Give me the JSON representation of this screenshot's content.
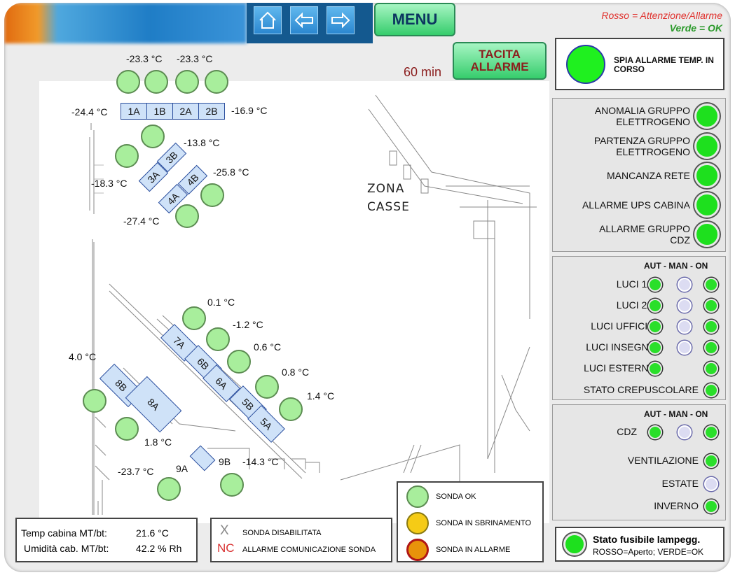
{
  "nav": {
    "menu_label": "MENU",
    "legend_red": "Rosso = Attenzione/Allarme",
    "legend_green": "Verde = OK"
  },
  "alarm": {
    "timer": "60 min",
    "tacita_line1": "TACITA",
    "tacita_line2": "ALLARME",
    "spia_label": "SPIA ALLARME TEMP. IN CORSO",
    "spia_color": "#1ff01f"
  },
  "alarms_panel": {
    "items": [
      {
        "line1": "ANOMALIA GRUPPO",
        "line2": "ELETTROGENO"
      },
      {
        "line1": "PARTENZA GRUPPO",
        "line2": "ELETTROGENO"
      },
      {
        "line1": "MANCANZA RETE",
        "line2": ""
      },
      {
        "line1": "ALLARME UPS CABINA",
        "line2": ""
      },
      {
        "line1": "ALLARME GRUPPO",
        "line2": "CDZ"
      }
    ]
  },
  "lights_panel": {
    "header": "AUT - MAN - ON",
    "rows": [
      {
        "label": "LUCI 1/2"
      },
      {
        "label": "LUCI 2/2"
      },
      {
        "label": "LUCI UFFICIO"
      },
      {
        "label": "LUCI INSEGNE"
      },
      {
        "label": "LUCI ESTERNE"
      },
      {
        "label": "STATO CREPUSCOLARE"
      }
    ]
  },
  "hvac_panel": {
    "header": "AUT - MAN - ON",
    "cdz_label": "CDZ",
    "ventilazione_label": "VENTILAZIONE",
    "estate_label": "ESTATE",
    "inverno_label": "INVERNO"
  },
  "fuse": {
    "title": "Stato fusibile lampegg.",
    "subtitle": "ROSSO=Aperto; VERDE=OK"
  },
  "map": {
    "zone_line1": "ZONA",
    "zone_line2": "CASSE",
    "cells": {
      "c1A": "1A",
      "c1B": "1B",
      "c2A": "2A",
      "c2B": "2B",
      "c3A": "3A",
      "c3B": "3B",
      "c4A": "4A",
      "c4B": "4B",
      "c5A": "5A",
      "c5B": "5B",
      "c6A": "6A",
      "c6B": "6B",
      "c7A": "7A",
      "c8A": "8A",
      "c8B": "8B",
      "c9A": "9A",
      "c9B": "9B"
    },
    "temps": {
      "t1": "-23.3 °C",
      "t2": "-23.3 °C",
      "t1A": "-24.4 °C",
      "t2B": "-16.9 °C",
      "t3B": "-13.8 °C",
      "t3A": "-18.3 °C",
      "t4B": "-25.8 °C",
      "t4A": "-27.4 °C",
      "t7A": "0.1 °C",
      "t6B": "-1.2 °C",
      "t6A": "0.6 °C",
      "t5B": "0.8 °C",
      "t5A": "1.4 °C",
      "t8B": "4.0 °C",
      "t8A": "1.8 °C",
      "t9A": "-23.7 °C",
      "t9B": "-14.3 °C"
    }
  },
  "sensor_legend": {
    "ok": "SONDA OK",
    "defrost": "SONDA IN SBRINAMENTO",
    "alarm": "SONDA IN ALLARME"
  },
  "status_box": {
    "temp_label": "Temp cabina MT/bt:",
    "temp_value": "21.6 °C",
    "hum_label": "Umidità cab. MT/bt:",
    "hum_value": "42.2 % Rh"
  },
  "probe_legend": {
    "x_symbol": "X",
    "x_text": "SONDA DISABILITATA",
    "nc_symbol": "NC",
    "nc_text": "ALLARME COMUNICAZIONE SONDA"
  },
  "colors": {
    "led_green": "#1ee01e",
    "sensor_ok": "#a8ee9c",
    "sensor_defrost": "#f5cb16",
    "sensor_alarm": "#e8930b"
  }
}
